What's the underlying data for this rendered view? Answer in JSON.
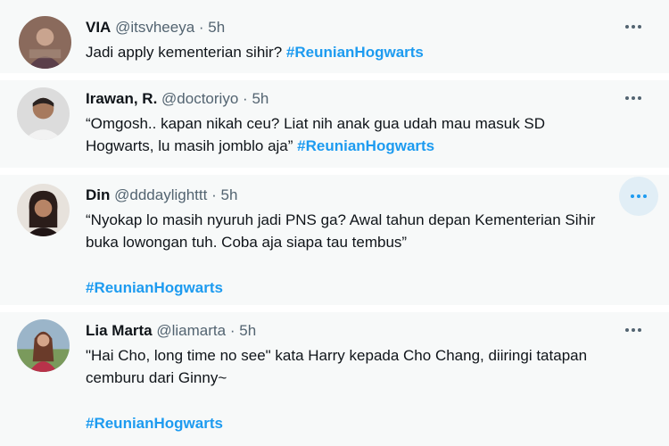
{
  "tweets": [
    {
      "name": "VIA",
      "handle": "@itsvheeya",
      "dot": "·",
      "time": "5h",
      "text": "Jadi apply kementerian sihir? ",
      "hashtag": "#ReunianHogwarts"
    },
    {
      "name": "Irawan, R.",
      "handle": "@doctoriyo",
      "dot": "·",
      "time": "5h",
      "text_line1": "“Omgosh.. kapan nikah ceu? Liat nih anak gua udah mau masuk SD",
      "text_line2": "Hogwarts, lu masih jomblo aja” ",
      "hashtag": "#ReunianHogwarts"
    },
    {
      "name": "Din",
      "handle": "@dddaylighttt",
      "dot": "·",
      "time": "5h",
      "text_line1": "“Nyokap lo masih nyuruh jadi PNS ga? Awal tahun depan Kementerian Sihir",
      "text_line2": "buka lowongan tuh. Coba aja siapa tau tembus”",
      "hashtag": "#ReunianHogwarts"
    },
    {
      "name": "Lia Marta",
      "handle": "@liamarta",
      "dot": "·",
      "time": "5h",
      "text_line1": "\"Hai Cho, long time no see\" kata Harry kepada Cho Chang, diiringi tatapan",
      "text_line2": "cemburu dari Ginny~",
      "hashtag": "#ReunianHogwarts"
    }
  ],
  "colors": {
    "accent": "#1d9bf0",
    "muted": "#536471",
    "text": "#0f1419",
    "card_bg": "#f7f9f9"
  },
  "icons": {
    "more": "more-horizontal-icon"
  }
}
